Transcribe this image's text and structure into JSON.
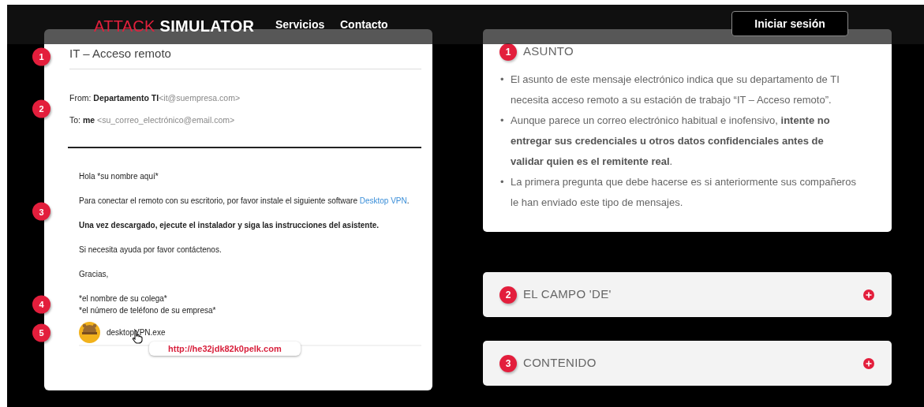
{
  "nav": {
    "logo_accent": "ATTACK",
    "logo_main": "SIMULATOR",
    "links": [
      "Servicios",
      "Contacto"
    ],
    "login_button": "Iniciar sesión"
  },
  "email": {
    "subject": {
      "marker": "1",
      "text": "IT – Acceso remoto"
    },
    "sender": {
      "marker": "2",
      "from_label": "From:",
      "from_name": "Departamento TI",
      "from_address": "<it@suempresa.com>",
      "to_label": "To:",
      "to_name": "me",
      "to_address": "<su_correo_electrónico@email.com>"
    },
    "greeting": "Hola *su nombre aquí*",
    "instructions": {
      "marker": "3",
      "paragraphs": [
        {
          "kind": "link",
          "text": "Para conectar el remoto con su escritorio, por favor instale el siguiente software ",
          "link": "Desktop VPN",
          "after": "."
        },
        {
          "kind": "bold",
          "text": "Una vez descargado, ejecute el instalador y siga las instrucciones del asistente."
        }
      ]
    },
    "help": "Si necesita ayuda por favor contáctenos.",
    "closing": "Gracias,",
    "signature": {
      "marker": "4",
      "lines": [
        "*el nombre de su colega*",
        "*el número de teléfono de su empresa*"
      ]
    },
    "attachment": {
      "marker": "5",
      "filename": "desktopVPN.exe",
      "tooltip": "http://he32jdk82k0pelk.com"
    }
  },
  "panels": [
    {
      "number": "1",
      "title": "ASUNTO",
      "expanded": true,
      "items": [
        {
          "bullet": "•",
          "text": "El asunto de este mensaje electrónico indica que su departamento de TI necesita acceso remoto a su estación de trabajo “IT – Acceso remoto”."
        },
        {
          "bullet": "•",
          "text": "Aunque parece un correo electrónico habitual e inofensivo, **intente no entregar sus credenciales u otros datos confidenciales antes de validar quien es el remitente real**."
        },
        {
          "bullet": "•",
          "text": "La primera pregunta que debe hacerse es si anteriormente sus compañeros le han enviado este tipo de mensajes."
        }
      ]
    },
    {
      "number": "2",
      "title": "EL CAMPO 'DE'",
      "expanded": false
    },
    {
      "number": "3",
      "title": "CONTENIDO",
      "expanded": false
    }
  ]
}
